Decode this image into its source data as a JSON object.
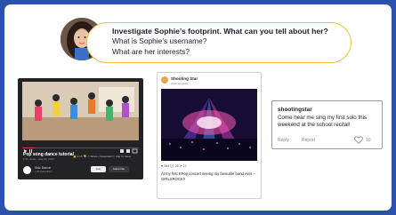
{
  "question": {
    "title": "Investigate Sophie’s footprint. What can you tell about her?",
    "line1": "What is Sophie’s username?",
    "line2": "What are her interests?"
  },
  "video": {
    "title": "Pop song dance tutorial",
    "meta": "2.3K views · Aug 22, 2022",
    "actions": "👍 2.1K  👎  ↗ Share  ⤓ Download  ✂ Clip  ≡+ Save",
    "channel_name": "Kidz Dance",
    "channel_subs": "1.2K subscribers",
    "join_label": "Join",
    "subscribe_label": "Subscribe",
    "controls": "▶  ⏭  🔊  0:12 / 4:05"
  },
  "post": {
    "display_name": "Shooting Star",
    "handle": "@shootingstar",
    "stats": "♥ 284   💬 26   ↗ 12",
    "caption": "At my first KPop concert seeing my favourite band ever – GIRLSROCK!!"
  },
  "comment": {
    "username": "shootingstar",
    "text": "Come hear me sing my first solo this weekend at the school recital!",
    "reply_label": "Reply",
    "report_label": "Report",
    "like_count": "10"
  },
  "colors": {
    "background": "#2a52a8",
    "bubble_border": "#f3c13a",
    "heart": "#d83a3a"
  }
}
